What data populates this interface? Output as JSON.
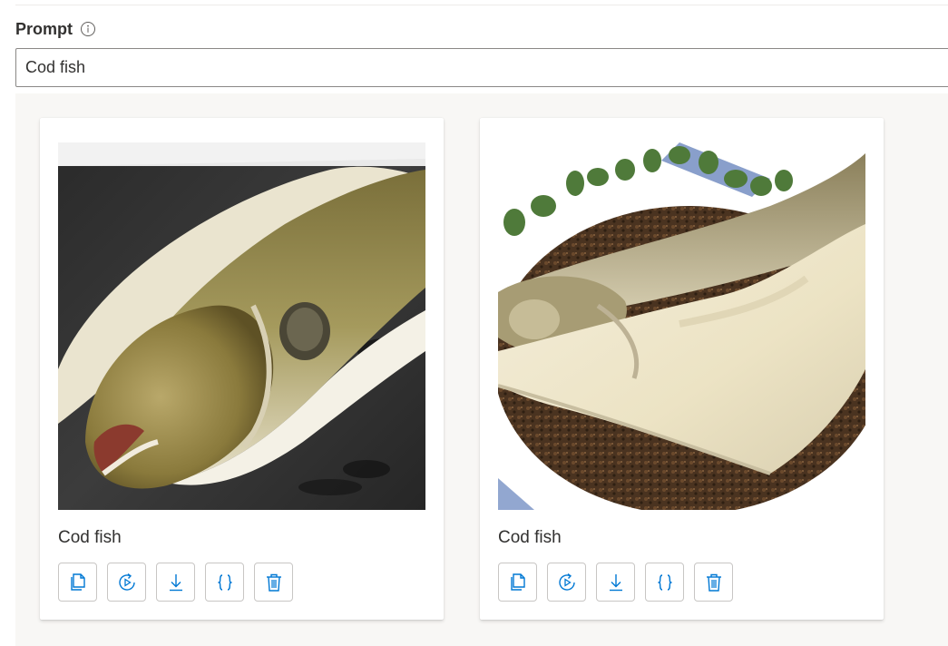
{
  "prompt": {
    "label": "Prompt",
    "value": "Cod fish",
    "info_icon": "info-icon"
  },
  "accent_color": "#0078d4",
  "results": [
    {
      "caption": "Cod fish",
      "image_alt": "Whole cod fish lying on a dark tray",
      "actions": [
        "copy-icon",
        "play-variation-icon",
        "download-icon",
        "json-icon",
        "delete-icon"
      ]
    },
    {
      "caption": "Cod fish",
      "image_alt": "Cod fillet on dark seaweed mat with green leaves",
      "actions": [
        "copy-icon",
        "play-variation-icon",
        "download-icon",
        "json-icon",
        "delete-icon"
      ]
    }
  ]
}
